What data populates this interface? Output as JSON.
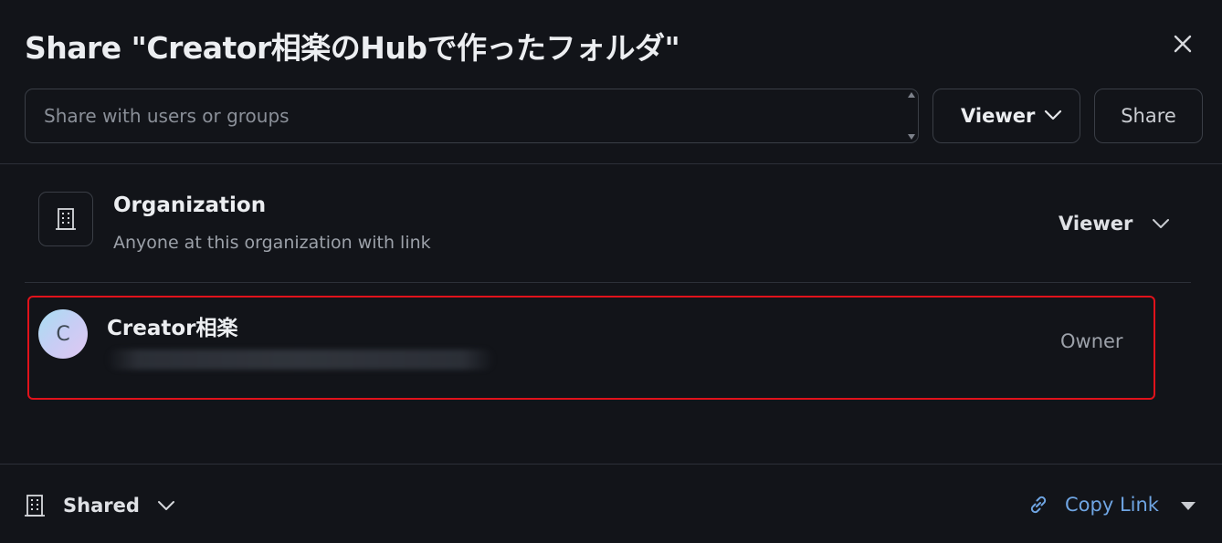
{
  "dialog": {
    "title": "Share \"Creator相楽のHubで作ったフォルダ\"",
    "close_icon": "close-icon"
  },
  "share_form": {
    "search_placeholder": "Share with users or groups",
    "search_value": "",
    "role_select_value": "Viewer",
    "share_button_label": "Share"
  },
  "access_list": [
    {
      "type": "organization",
      "icon": "building-icon",
      "name": "Organization",
      "description": "Anyone at this organization with link",
      "role": "Viewer"
    },
    {
      "type": "user",
      "avatar_initial": "C",
      "name": "Creator相楽",
      "role": "Owner"
    }
  ],
  "footer": {
    "visibility_icon": "building-icon",
    "visibility_label": "Shared",
    "copy_link_icon": "link-icon",
    "copy_link_label": "Copy Link"
  },
  "colors": {
    "background": "#121419",
    "border": "#3a3e46",
    "accent_link": "#6fa5e3",
    "highlight_border": "#e0121b"
  }
}
